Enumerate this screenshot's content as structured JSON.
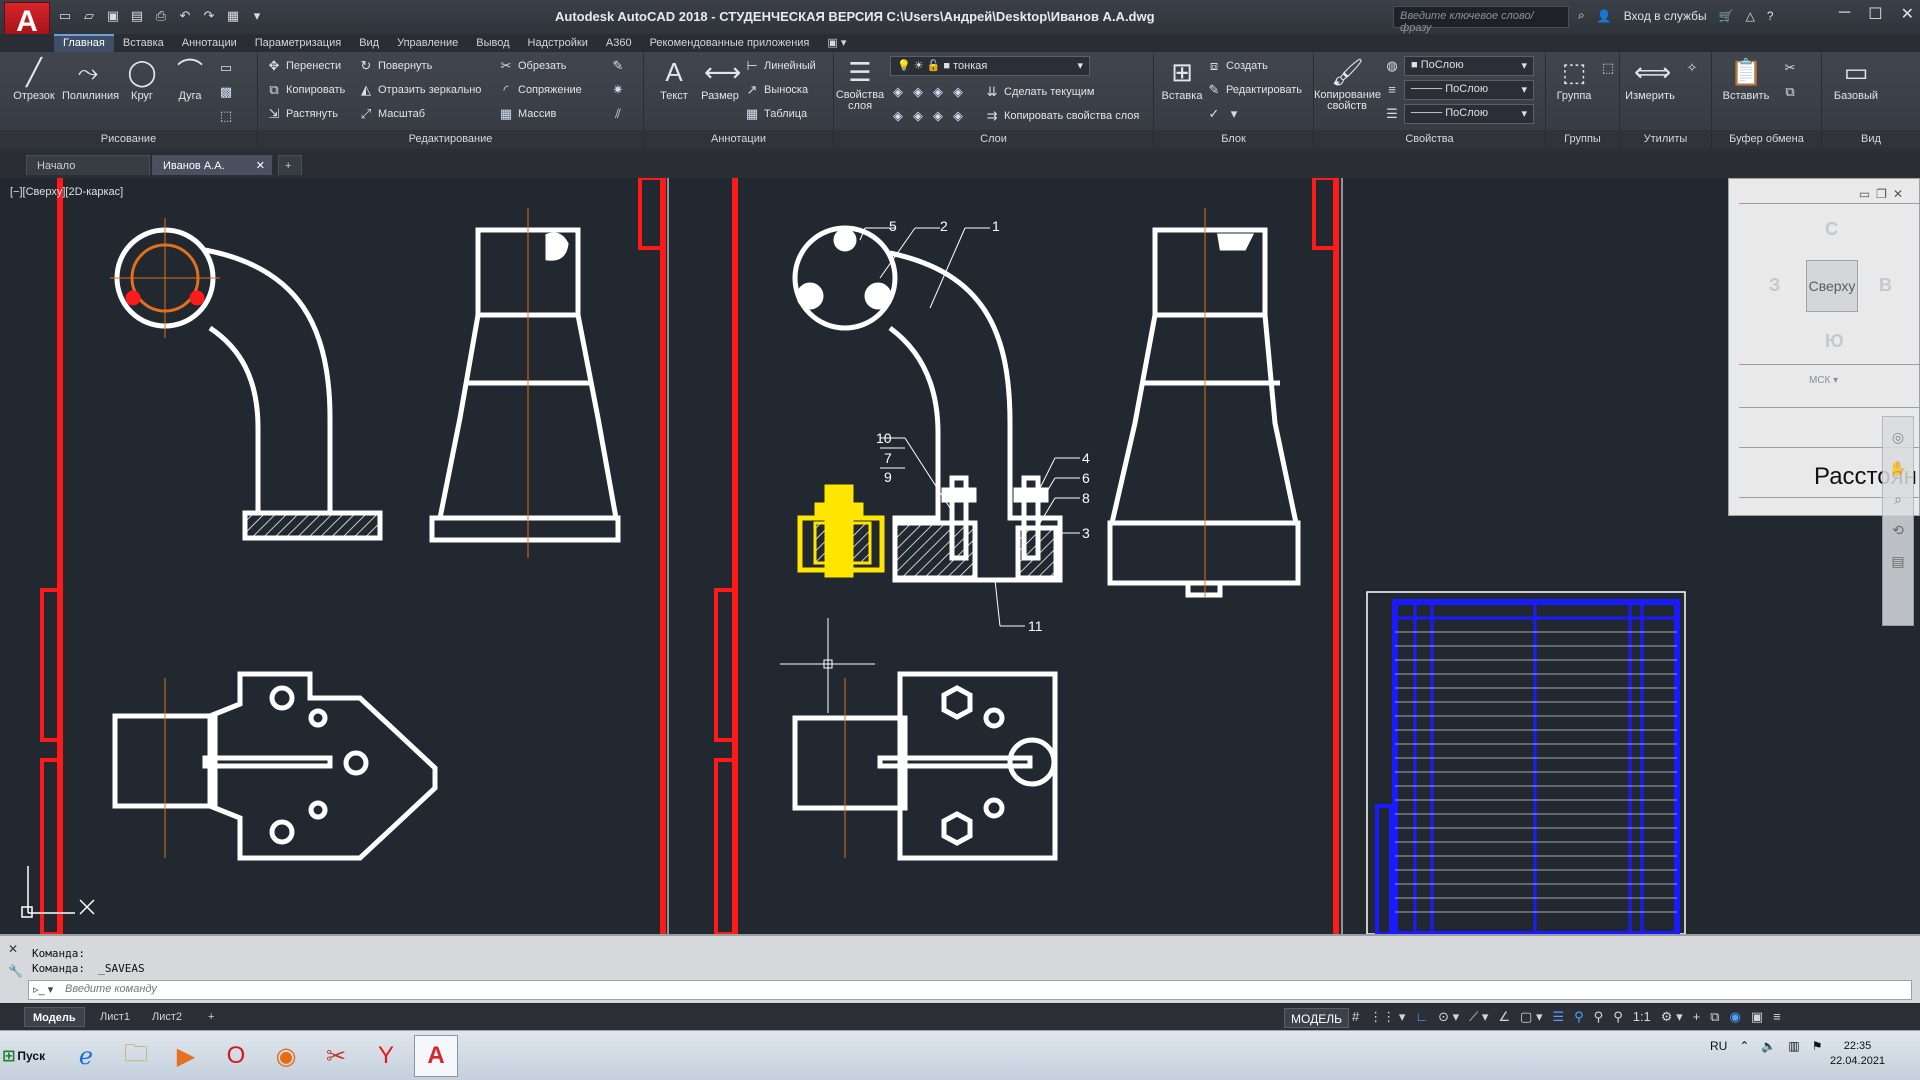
{
  "window": {
    "title": "Autodesk AutoCAD 2018 - СТУДЕНЧЕСКАЯ ВЕРСИЯ    C:\\Users\\Андрей\\Desktop\\Иванов А.А.dwg",
    "search_placeholder": "Введите ключевое слово/фразу",
    "signin": "Вход в службы",
    "logo": "A"
  },
  "ribbon_tabs": [
    "Главная",
    "Вставка",
    "Аннотации",
    "Параметризация",
    "Вид",
    "Управление",
    "Вывод",
    "Надстройки",
    "A360",
    "Рекомендованные приложения"
  ],
  "ribbon": {
    "draw": {
      "title": "Рисование",
      "line": "Отрезок",
      "polyline": "Полилиния",
      "circle": "Круг",
      "arc": "Дуга"
    },
    "modify": {
      "title": "Редактирование",
      "move": "Перенести",
      "rotate": "Повернуть",
      "trim": "Обрезать",
      "copy": "Копировать",
      "mirror": "Отразить зеркально",
      "fillet": "Сопряжение",
      "stretch": "Растянуть",
      "scale": "Масштаб",
      "array": "Массив"
    },
    "annotation": {
      "title": "Аннотации",
      "text": "Текст",
      "dimension": "Размер",
      "linear": "Линейный",
      "leader": "Выноска",
      "table": "Таблица"
    },
    "layers": {
      "title": "Слои",
      "properties": "Свойства\nслоя",
      "current_layer": "тонкая",
      "make_current": "Сделать текущим",
      "match_layer": "Копировать свойства слоя"
    },
    "block": {
      "title": "Блок",
      "insert": "Вставка",
      "create": "Создать",
      "edit": "Редактировать"
    },
    "properties": {
      "title": "Свойства",
      "match": "Копирование\nсвойств",
      "color": "ПоСлою",
      "lineweight": "ПоСлою",
      "linetype": "ПоСлою"
    },
    "groups": {
      "title": "Группы",
      "group": "Группа"
    },
    "utilities": {
      "title": "Утилиты",
      "measure": "Измерить"
    },
    "clipboard": {
      "title": "Буфер обмена",
      "paste": "Вставить"
    },
    "view": {
      "title": "Вид",
      "base": "Базовый"
    }
  },
  "doc_tabs": [
    "Начало",
    "Иванов А.А."
  ],
  "viewport_label": "[−][Сверху][2D-каркас]",
  "balloons": [
    "5",
    "2",
    "1",
    "10",
    "7",
    "9",
    "4",
    "6",
    "8",
    "3",
    "11"
  ],
  "viewcube": {
    "top": "Сверху",
    "north": "С",
    "south": "Ю",
    "west": "З",
    "east": "В",
    "ucs": "МСК",
    "distance": "Расстоян"
  },
  "command": {
    "history": [
      "Команда:",
      "Команда:  _SAVEAS"
    ],
    "placeholder": "Введите команду"
  },
  "layout_tabs": [
    "Модель",
    "Лист1",
    "Лист2"
  ],
  "status": {
    "space": "МОДЕЛЬ",
    "scale": "1:1"
  },
  "taskbar": {
    "start": "Пуск",
    "lang": "RU",
    "time": "22:35",
    "date": "22.04.2021"
  },
  "colors": {
    "accent": "#d7252b",
    "frame": "#ff1a1a",
    "highlight": "#ffe600",
    "spec_table": "#1a1aff"
  }
}
